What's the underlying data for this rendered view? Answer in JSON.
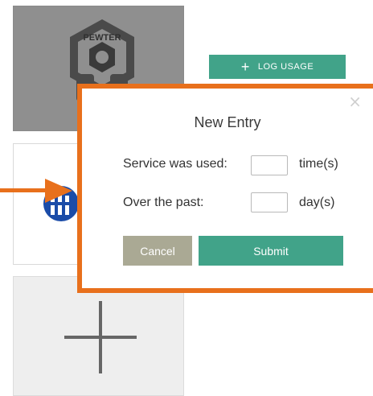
{
  "tiles": {
    "pewter": {
      "logo_text": "PEWTER"
    },
    "blue": {},
    "add": {
      "icon": "plus-icon"
    }
  },
  "log_usage": {
    "label": "LOG USAGE",
    "icon": "plus-icon"
  },
  "modal": {
    "title": "New Entry",
    "close_icon": "×",
    "rows": [
      {
        "label": "Service was used:",
        "value": "",
        "unit": "time(s)"
      },
      {
        "label": "Over the past:",
        "value": "",
        "unit": "day(s)"
      }
    ],
    "cancel_label": "Cancel",
    "submit_label": "Submit"
  },
  "colors": {
    "accent": "#41a389",
    "callout": "#e8701c",
    "cancel": "#aaa994",
    "tile_grey": "#8f8f8f"
  }
}
